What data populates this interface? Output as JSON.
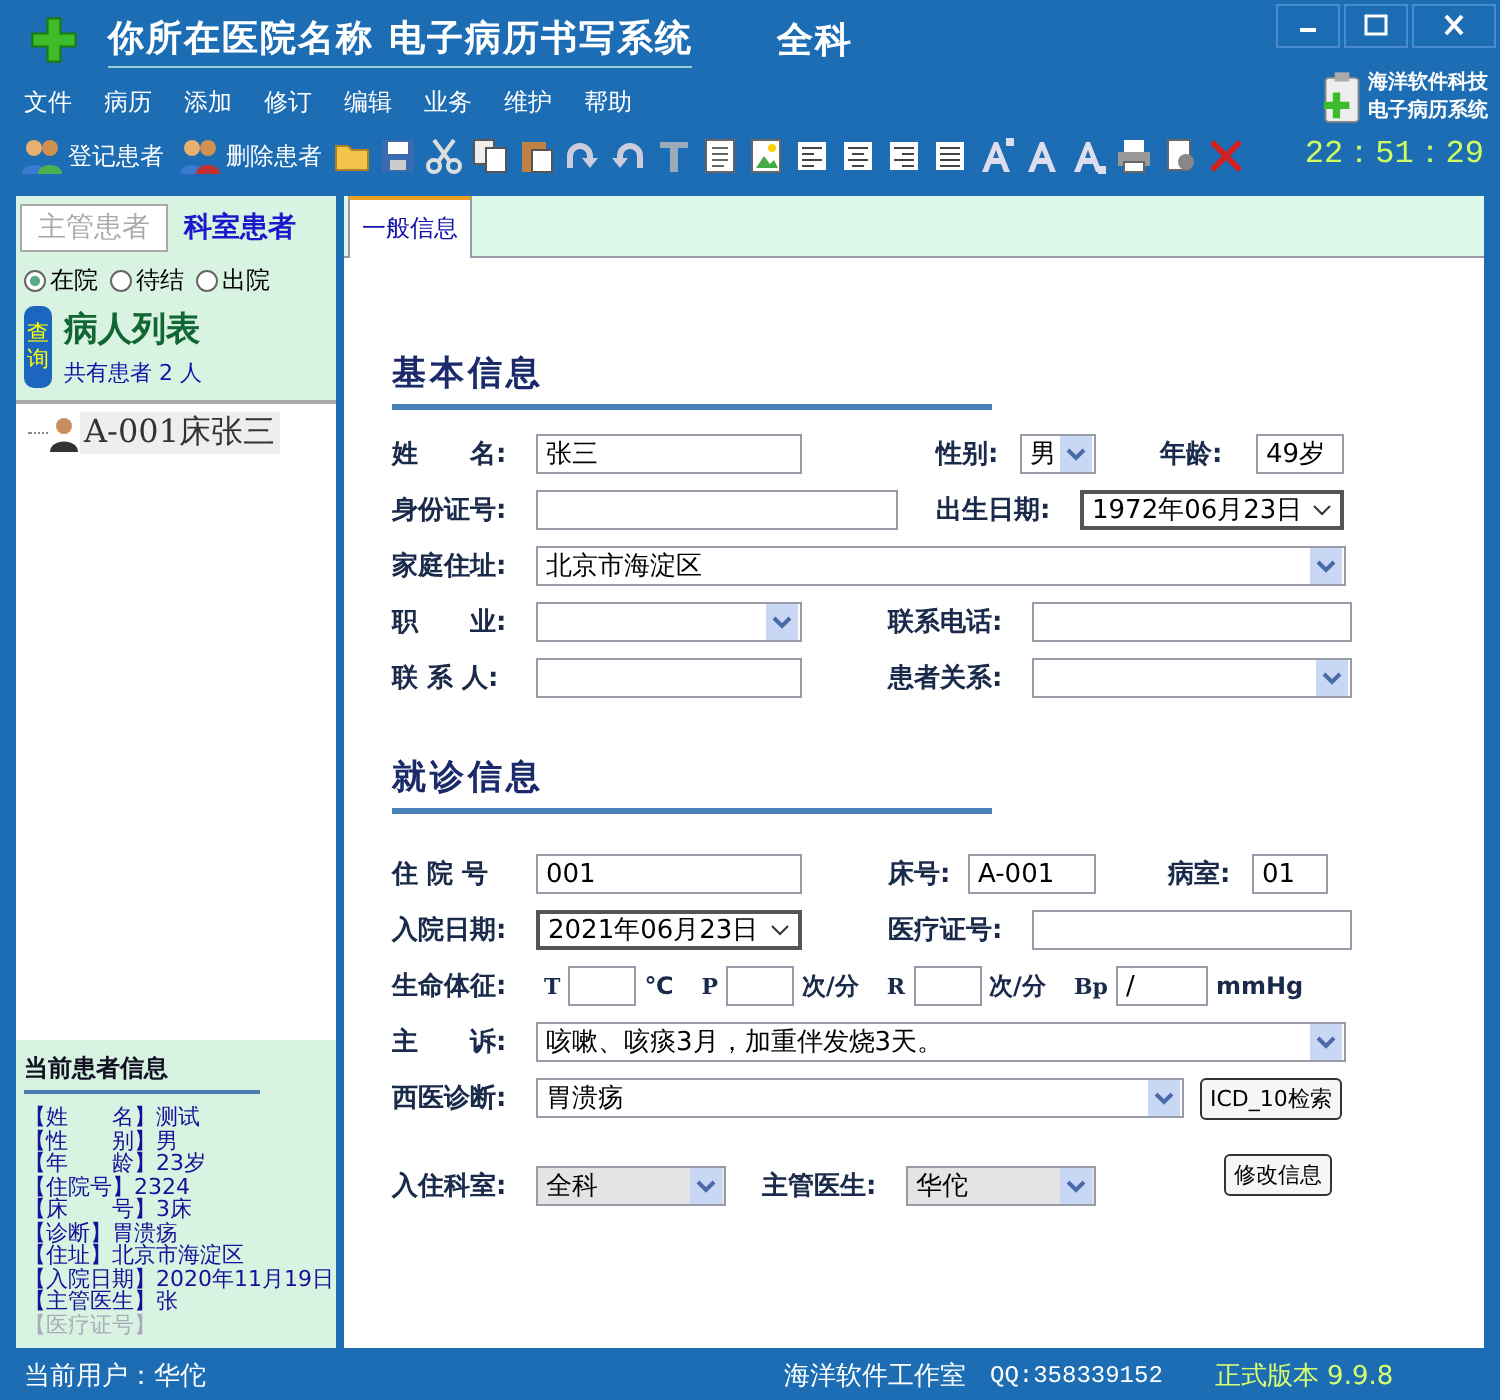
{
  "window": {
    "title": "你所在医院名称  电子病历书写系统",
    "department": "全科"
  },
  "menu": [
    "文件",
    "病历",
    "添加",
    "修订",
    "编辑",
    "业务",
    "维护",
    "帮助"
  ],
  "toolbar": {
    "buttons": [
      {
        "label": "登记患者"
      },
      {
        "label": "删除患者"
      }
    ]
  },
  "brand": {
    "line1": "海洋软件科技",
    "line2": "电子病历系统"
  },
  "clock": "22：51：29",
  "sidebar": {
    "tabs": [
      {
        "label": "主管患者",
        "selected": false
      },
      {
        "label": "科室患者",
        "selected": true
      }
    ],
    "filters": [
      {
        "label": "在院",
        "selected": true
      },
      {
        "label": "待结",
        "selected": false
      },
      {
        "label": "出院",
        "selected": false
      }
    ],
    "query_button": "查询",
    "list_title": "病人列表",
    "count_text": "共有患者 2 人",
    "patients": [
      {
        "label": "A-001床张三",
        "selected": true
      }
    ],
    "current": {
      "title": "当前患者信息",
      "rows": [
        {
          "key": "【姓　　名】",
          "value": "测试",
          "dimmed": false
        },
        {
          "key": "【性　　别】",
          "value": "男",
          "dimmed": false
        },
        {
          "key": "【年　　龄】",
          "value": "23岁",
          "dimmed": false
        },
        {
          "key": "【住院号】",
          "value": "2324",
          "dimmed": false
        },
        {
          "key": "【床　　号】",
          "value": "3床",
          "dimmed": false
        },
        {
          "key": "【诊断】",
          "value": "胃溃疡",
          "dimmed": false
        },
        {
          "key": "【住址】",
          "value": "北京市海淀区",
          "dimmed": false
        },
        {
          "key": "【入院日期】",
          "value": "2020年11月19日",
          "dimmed": false
        },
        {
          "key": "【主管医生】",
          "value": "张",
          "dimmed": false
        },
        {
          "key": "【医疗证号】",
          "dimmed": true
        }
      ]
    }
  },
  "form": {
    "tabs": [
      {
        "label": "一般信息",
        "selected": true
      }
    ],
    "basic": {
      "title": "基本信息",
      "name": {
        "label": "姓　　名:",
        "value": "张三"
      },
      "sex": {
        "label": "性别:",
        "value": "男"
      },
      "age": {
        "label": "年龄:",
        "value": "49岁"
      },
      "id_no": {
        "label": "身份证号:"
      },
      "birth": {
        "label": "出生日期:",
        "value": "1972年06月23日"
      },
      "address": {
        "label": "家庭住址:",
        "value": "北京市海淀区"
      },
      "job": {
        "label": "职　　业:"
      },
      "phone": {
        "label": "联系电话:"
      },
      "contact": {
        "label": "联 系 人:"
      },
      "relation": {
        "label": "患者关系:"
      }
    },
    "visit": {
      "title": "就诊信息",
      "admission_no": {
        "label": "住 院 号",
        "value": "001"
      },
      "bed": {
        "label": "床号:",
        "value": "A-001"
      },
      "ward": {
        "label": "病室:",
        "value": "01"
      },
      "admit_date": {
        "label": "入院日期:",
        "value": "2021年06月23日"
      },
      "insurance_no": {
        "label": "医疗证号:"
      },
      "vitals": {
        "label": "生命体征:",
        "items": [
          {
            "prefix": "T",
            "unit": "℃"
          },
          {
            "prefix": "P",
            "unit": "次/分"
          },
          {
            "prefix": "R",
            "unit": "次/分"
          },
          {
            "prefix": "Bp",
            "value": "/",
            "unit": "mmHg"
          }
        ]
      },
      "complaint": {
        "label": "主　　诉:",
        "value": "咳嗽、咳痰3月，加重伴发烧3天。"
      },
      "diagnosis": {
        "label": "西医诊断:",
        "value": "胃溃疡"
      },
      "icd_button": "ICD_10检索",
      "department": {
        "label": "入住科室:",
        "value": "全科"
      },
      "doctor": {
        "label": "主管医生:",
        "value": "华佗"
      },
      "edit_button": "修改信息"
    }
  },
  "status_bar": {
    "user": "当前用户：华佗",
    "studio": "海洋软件工作室",
    "qq": "QQ:358339152",
    "version": "正式版本 9.9.8"
  }
}
